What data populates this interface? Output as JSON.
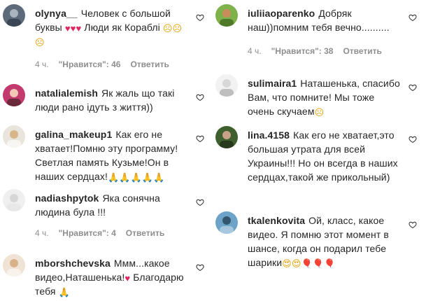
{
  "left": [
    {
      "username": "olynya__",
      "text_parts": [
        {
          "t": "Человек с большой буквы "
        },
        {
          "e": "♥",
          "c": "red"
        },
        {
          "e": "♥",
          "c": "red"
        },
        {
          "e": "♥",
          "c": "red"
        },
        {
          "t": " Люди як Кораблі "
        },
        {
          "e": "☹",
          "c": "yellow"
        },
        {
          "e": "☹",
          "c": "yellow"
        },
        {
          "e": "☹",
          "c": "yellow"
        }
      ],
      "time": "4 ч.",
      "likes": "\"Нравится\": 46",
      "reply": "Ответить",
      "avatar_colors": [
        "#5d6a7a",
        "#a9b4bf",
        "#3a4654"
      ]
    },
    {
      "username": "natalialemish",
      "text_parts": [
        {
          "t": "Як жаль що такі люди рано ідуть з життя))"
        }
      ],
      "time": "",
      "likes": "",
      "reply": "",
      "avatar_colors": [
        "#c23a6e",
        "#f2c7b8",
        "#6a2a3a"
      ]
    },
    {
      "username": "galina_makeup1",
      "text_parts": [
        {
          "t": "Как его не хватает!Помню эту программу! Светлая память Кузьме!Он в наших сердцах!"
        },
        {
          "e": "🙏",
          "c": "gold"
        },
        {
          "e": "🙏",
          "c": "gold"
        },
        {
          "e": "🙏",
          "c": "gold"
        },
        {
          "e": "🙏",
          "c": "gold"
        },
        {
          "e": "🙏",
          "c": "gold"
        }
      ],
      "time": "",
      "likes": "",
      "reply": "",
      "avatar_colors": [
        "#e9e4dc",
        "#d9b68a",
        "#f8f6f2"
      ]
    },
    {
      "username": "nadiashpytok",
      "text_parts": [
        {
          "t": "Яка сонячна людина була !!!"
        }
      ],
      "time": "4 ч.",
      "likes": "\"Нравится\": 4",
      "reply": "Ответить",
      "avatar_colors": [
        "#efefef",
        "#d6d6d6",
        "#e8e8e8"
      ]
    },
    {
      "username": "mborshchevska",
      "text_parts": [
        {
          "t": "Ммм...какое видео,Наташенька!"
        },
        {
          "e": "♥",
          "c": "red"
        },
        {
          "t": " Благодарю тебя "
        },
        {
          "e": "🙏",
          "c": "gold"
        }
      ],
      "time": "",
      "likes": "",
      "reply": "",
      "avatar_colors": [
        "#f0e3d6",
        "#d9b28b",
        "#f9f2ea"
      ]
    }
  ],
  "right": [
    {
      "username": "iuliiaoparenko",
      "text_parts": [
        {
          "t": "Добряк наш))помним тебя вечно.........."
        }
      ],
      "time": "4 ч.",
      "likes": "\"Нравится\": 38",
      "reply": "Ответить",
      "avatar_colors": [
        "#7fb24a",
        "#c98c5a",
        "#4f7a2a"
      ]
    },
    {
      "username": "sulimaira1",
      "text_parts": [
        {
          "t": "Наташенька, спасибо Вам, что помните! Мы тоже очень скучаем"
        },
        {
          "e": "☹",
          "c": "yellow"
        }
      ],
      "time": "",
      "likes": "",
      "reply": "",
      "avatar_colors": [
        "#f2f2f2",
        "#d8d8d8",
        "#bfbfbf"
      ]
    },
    {
      "username": "lina.4158",
      "text_parts": [
        {
          "t": "Как его не хватает,это большая утрата для всей Украины!!! Но он всегда в наших сердцах,такой же прикольный)"
        }
      ],
      "time": "",
      "likes": "",
      "reply": "",
      "avatar_colors": [
        "#3f5f2e",
        "#c9a189",
        "#27381d"
      ]
    },
    {
      "username": "tkalenkovita",
      "text_parts": [
        {
          "t": "Ой, класс, какое видео. Я помню этот момент в шансе, когда он подарил тебе шарики"
        },
        {
          "e": "😍",
          "c": "yellow"
        },
        {
          "e": "😍",
          "c": "yellow"
        },
        {
          "e": "🎈",
          "c": "red"
        },
        {
          "e": "🎈",
          "c": "red"
        },
        {
          "e": "🎈",
          "c": "red"
        }
      ],
      "time": "",
      "likes": "",
      "reply": "",
      "avatar_colors": [
        "#6ea3c9",
        "#33566e",
        "#a6c7de"
      ]
    }
  ]
}
